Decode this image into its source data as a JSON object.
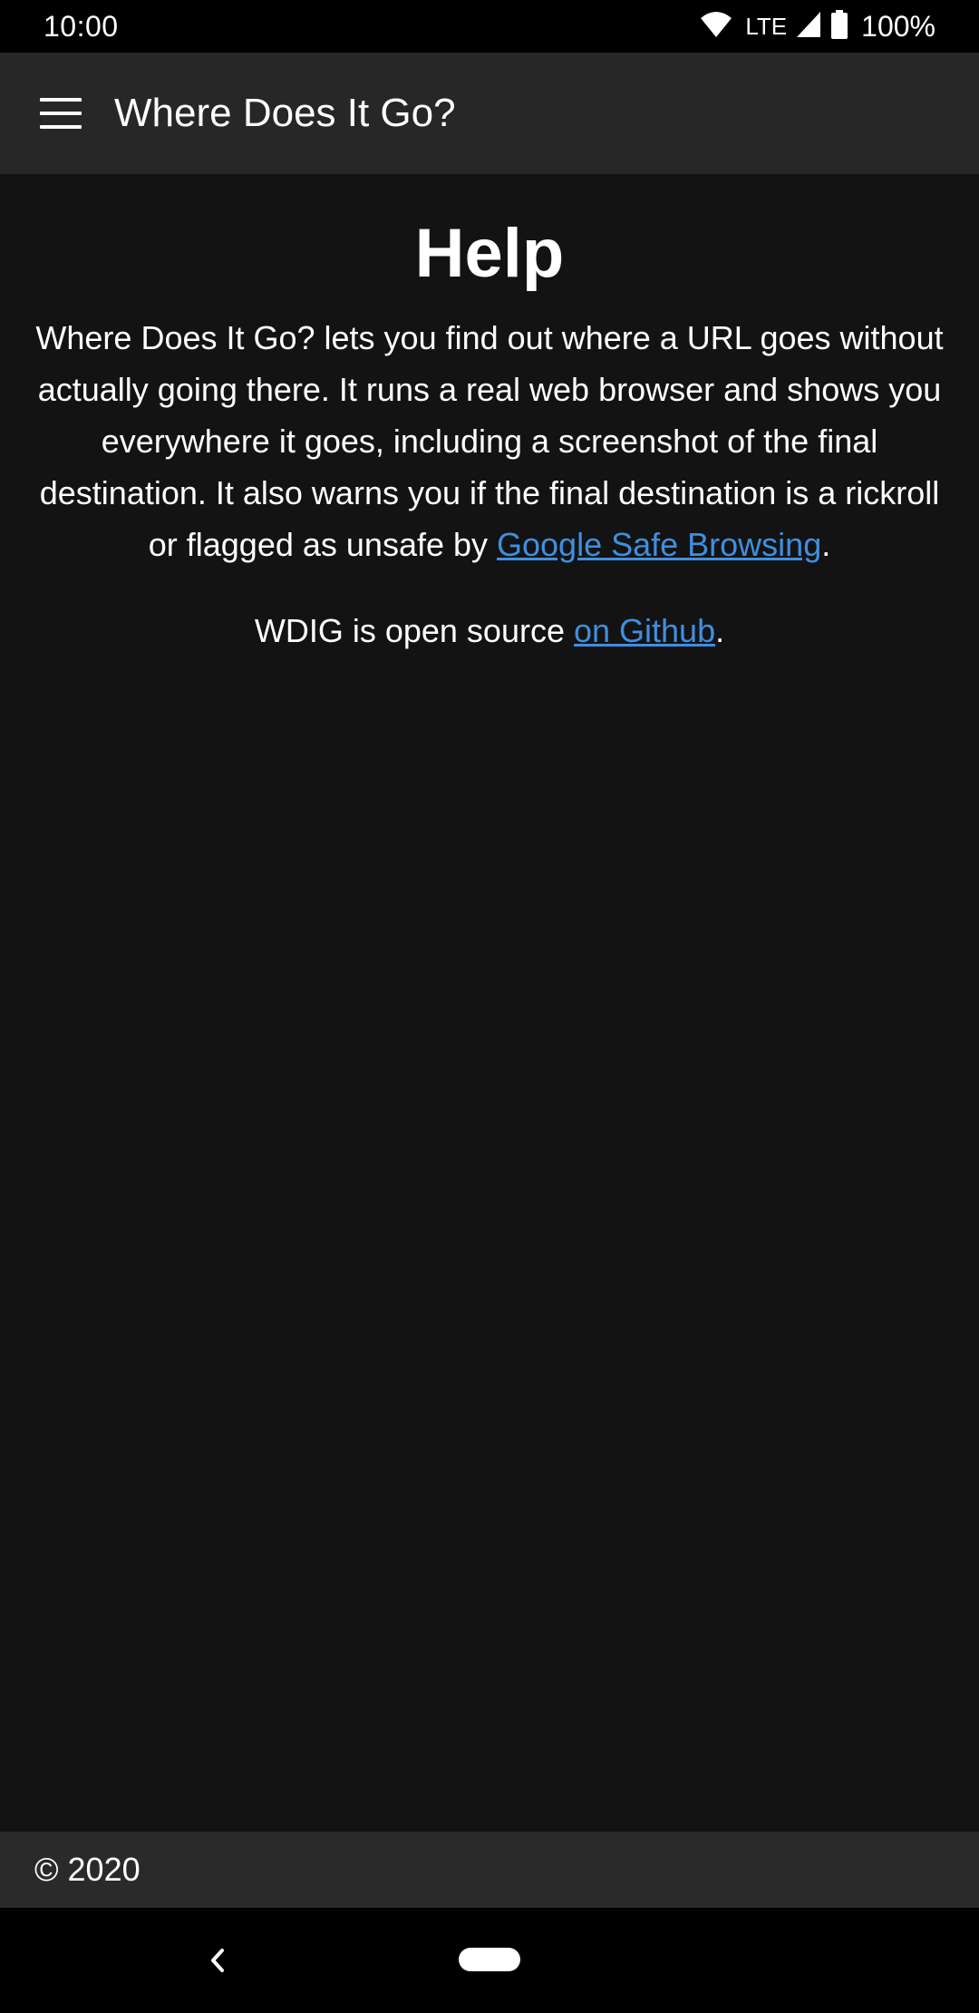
{
  "status_bar": {
    "time": "10:00",
    "network": "LTE",
    "battery": "100%",
    "icons": [
      "wifi-icon",
      "cell-signal-icon",
      "battery-icon"
    ]
  },
  "app_bar": {
    "menu_icon": "hamburger-menu-icon",
    "title": "Where Does It Go?"
  },
  "help": {
    "heading": "Help",
    "body_text": "Where Does It Go? lets you find out where a URL goes without actually going there. It runs a real web browser and shows you everywhere it goes, including a screenshot of the final destination. It also warns you if the final destination is a rickroll or flagged as unsafe by ",
    "safe_browsing_link": "Google Safe Browsing",
    "body_end": ".",
    "source_text": "WDIG is open source ",
    "github_link": "on Github",
    "source_end": "."
  },
  "footer": {
    "copyright": "© 2020"
  },
  "nav_bar": {
    "back_icon": "back-chevron-icon",
    "home_icon": "home-pill-icon"
  },
  "colors": {
    "background": "#131313",
    "app_bar": "#272727",
    "footer": "#2a2a2a",
    "link": "#3f8fe0",
    "text": "#ffffff"
  }
}
